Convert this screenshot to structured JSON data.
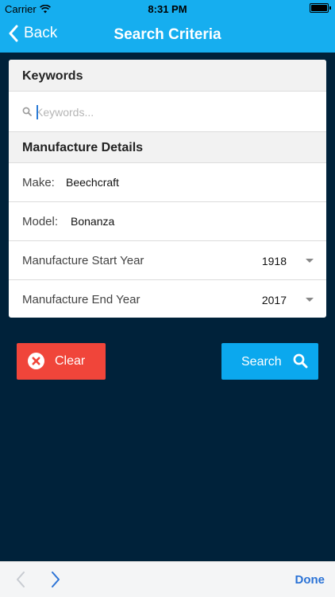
{
  "status_bar": {
    "carrier": "Carrier",
    "time": "8:31 PM"
  },
  "nav": {
    "back_label": "Back",
    "title": "Search Criteria"
  },
  "keywords": {
    "header": "Keywords",
    "placeholder": "Keywords...",
    "value": ""
  },
  "manufacture": {
    "header": "Manufacture Details",
    "make_label": "Make:",
    "make_value": "Beechcraft",
    "model_label": "Model:",
    "model_value": "Bonanza",
    "start_year_label": "Manufacture Start Year",
    "start_year_value": "1918",
    "end_year_label": "Manufacture End Year",
    "end_year_value": "2017"
  },
  "buttons": {
    "clear_label": "Clear",
    "search_label": "Search"
  },
  "toolbar": {
    "done_label": "Done"
  },
  "colors": {
    "accent": "#16aeef",
    "background": "#00223a",
    "clear_button": "#f0453a",
    "search_button": "#0ba8ee",
    "done": "#2b73d6"
  },
  "icons": [
    "wifi-icon",
    "battery-icon",
    "back-chevron-icon",
    "search-icon",
    "dropdown-arrow-icon",
    "clear-x-icon",
    "magnifier-icon",
    "prev-chevron-icon",
    "next-chevron-icon"
  ]
}
